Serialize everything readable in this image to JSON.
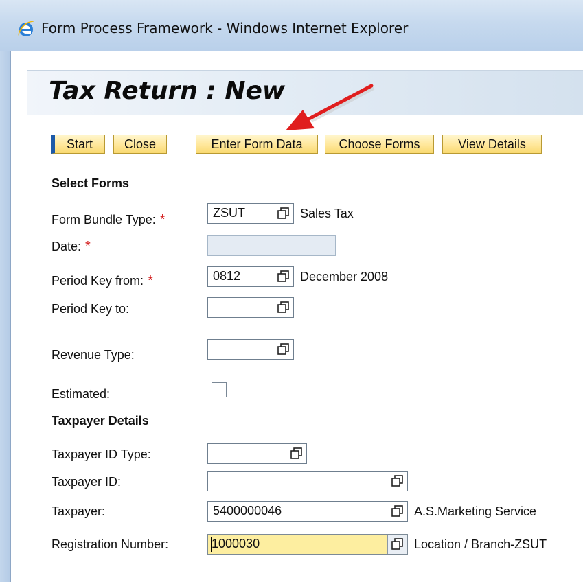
{
  "window": {
    "title": "Form Process Framework - Windows Internet Explorer",
    "icon": "internet-explorer-icon"
  },
  "page": {
    "title": "Tax Return : New"
  },
  "toolbar": {
    "start": "Start",
    "close": "Close",
    "enter_form_data": "Enter Form Data",
    "choose_forms": "Choose Forms",
    "view_details": "View Details"
  },
  "select_forms": {
    "heading": "Select Forms",
    "form_bundle_type": {
      "label": "Form Bundle Type:",
      "value": "ZSUT",
      "description": "Sales Tax",
      "required": true
    },
    "date": {
      "label": "Date:",
      "value": "",
      "required": true
    },
    "period_key_from": {
      "label": "Period Key from:",
      "value": "0812",
      "description": "December 2008",
      "required": true
    },
    "period_key_to": {
      "label": "Period Key to:",
      "value": ""
    },
    "revenue_type": {
      "label": "Revenue Type:",
      "value": ""
    },
    "estimated": {
      "label": "Estimated:",
      "checked": false
    }
  },
  "taxpayer_details": {
    "heading": "Taxpayer Details",
    "taxpayer_id_type": {
      "label": "Taxpayer ID Type:",
      "value": ""
    },
    "taxpayer_id": {
      "label": "Taxpayer ID:",
      "value": ""
    },
    "taxpayer": {
      "label": "Taxpayer:",
      "value": "5400000046",
      "description": "A.S.Marketing Service"
    },
    "registration_number": {
      "label": "Registration Number:",
      "value": "1000030",
      "description": "Location / Branch-ZSUT"
    }
  },
  "required_marker": "*",
  "colors": {
    "button_fill": "#ffe79a",
    "focus_field": "#fdeea0",
    "required": "#d42020",
    "annotation_arrow": "#e01e1e",
    "start_accent": "#1d5aa8"
  }
}
